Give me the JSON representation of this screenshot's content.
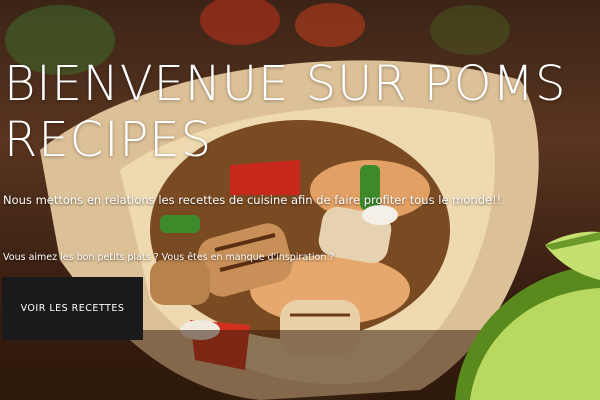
{
  "hero": {
    "title": "BIENVENUE SUR POMS RECIPES",
    "subtitle": "Nous mettons en relations les recettes de cuisine afin de faire profiter tous le monde!!",
    "tagline": "Vous aimez les bon petits plats ? Vous êtes en manque d'inspiration ?",
    "cta_label": "VOIR LES RECETTES",
    "background_image": "burrito-photo"
  },
  "colors": {
    "text": "#ffffff",
    "button_bg": "#1a1a1a",
    "lime": "#9cc443",
    "pepper_red": "#c8281c",
    "tortilla": "#e8cfa0"
  }
}
